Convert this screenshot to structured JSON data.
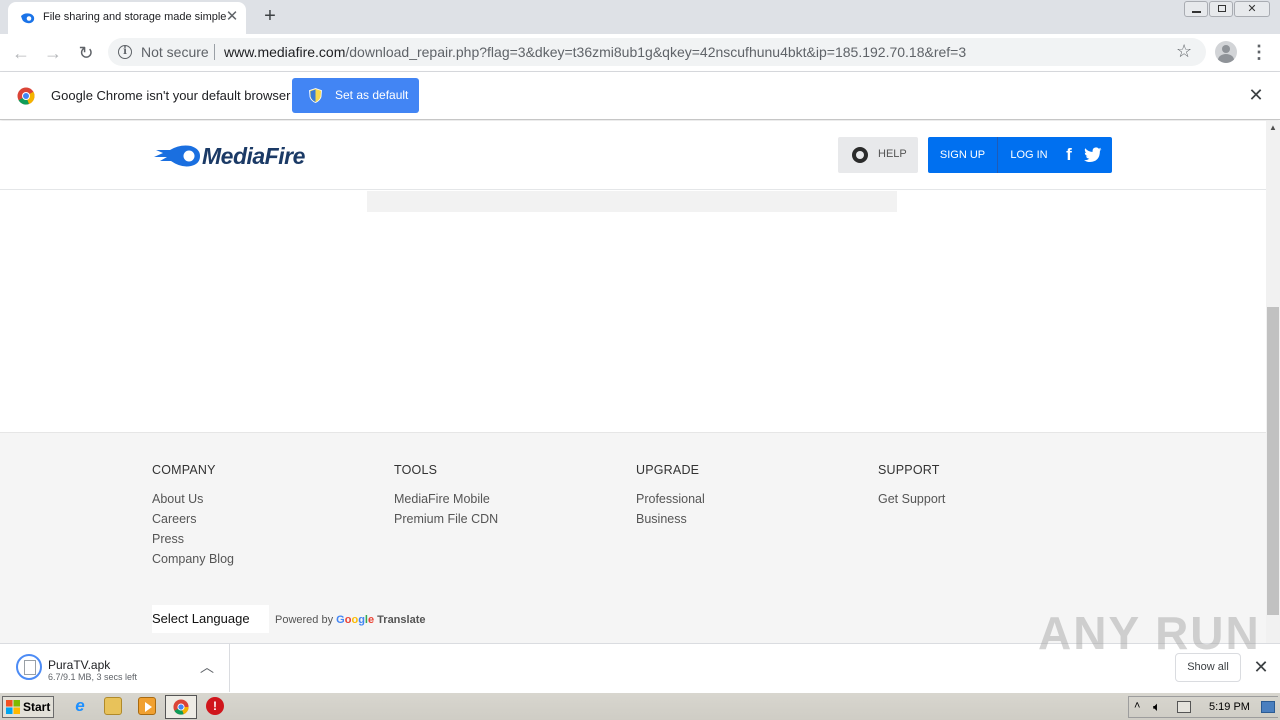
{
  "browser": {
    "tab_title": "File sharing and storage made simple",
    "not_secure": "Not secure",
    "url_host": "www.mediafire.com",
    "url_path": "/download_repair.php?flag=3&dkey=t36zmi8ub1g&qkey=42nscufhunu4bkt&ip=185.192.70.18&ref=3"
  },
  "infobar": {
    "message": "Google Chrome isn't your default browser",
    "set_default_label": "Set as default"
  },
  "site": {
    "logo_text": "MediaFire",
    "help_label": "HELP",
    "signup_label": "SIGN UP",
    "login_label": "LOG IN",
    "brand_color": "#0070f0"
  },
  "footer": {
    "columns": [
      {
        "heading": "COMPANY",
        "links": [
          "About Us",
          "Careers",
          "Press",
          "Company Blog"
        ]
      },
      {
        "heading": "TOOLS",
        "links": [
          "MediaFire Mobile",
          "Premium File CDN"
        ]
      },
      {
        "heading": "UPGRADE",
        "links": [
          "Professional",
          "Business"
        ]
      },
      {
        "heading": "SUPPORT",
        "links": [
          "Get Support"
        ]
      }
    ],
    "language_select": "Select Language",
    "powered_by": "Powered by",
    "google": "Google",
    "translate": "Translate"
  },
  "downloads": {
    "file_name": "PuraTV.apk",
    "status": "6.7/9.1 MB, 3 secs left",
    "show_all_label": "Show all"
  },
  "watermark": "ANY RUN",
  "taskbar": {
    "start_label": "Start",
    "clock": "5:19 PM"
  }
}
